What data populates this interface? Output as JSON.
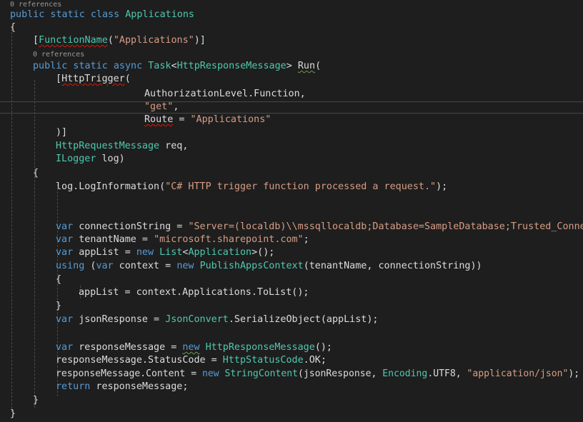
{
  "code_lens": {
    "class_refs": "0 references",
    "method_refs": "0 references"
  },
  "code": {
    "l1": {
      "kw": "public static class",
      "name": "Applications"
    },
    "l2": {
      "brace": "{"
    },
    "l3": {
      "open": "[",
      "attr": "FunctionName",
      "p1": "(",
      "str": "\"Applications\"",
      "close": ")]"
    },
    "l4": {
      "kw": "public static async",
      "task": "Task",
      "lt": "<",
      "resp": "HttpResponseMessage",
      "gt": ">",
      "run": "Run",
      "paren": "("
    },
    "l5": {
      "open": "[",
      "attr": "HttpTrigger",
      "paren": "("
    },
    "l6": {
      "text": "AuthorizationLevel.Function,"
    },
    "l7": {
      "str": "\"get\"",
      "comma": ","
    },
    "l8": {
      "route": "Route",
      "eq": " = ",
      "str": "\"Applications\""
    },
    "l9": {
      "text": ")]"
    },
    "l10": {
      "type": "HttpRequestMessage",
      "rest": " req,"
    },
    "l11": {
      "type": "ILogger",
      "rest": " log)"
    },
    "l12": {
      "brace": "{"
    },
    "l13": {
      "pre": "log.LogInformation(",
      "str": "\"C# HTTP trigger function processed a request.\"",
      "post": ");"
    },
    "l16": {
      "kw": "var",
      "mid": " connectionString = ",
      "str": "\"Server=(localdb)\\\\mssqllocaldb;Database=SampleDatabase;Trusted_Connect"
    },
    "l17": {
      "kw": "var",
      "mid": " tenantName = ",
      "str": "\"microsoft.sharepoint.com\"",
      "post": ";"
    },
    "l18": {
      "kw": "var",
      "mid": " appList = ",
      "kw2": "new",
      "type": "List",
      "lt": "<",
      "type2": "Application",
      "post": ">();"
    },
    "l19": {
      "kw": "using",
      "p1": " (",
      "kw2": "var",
      "mid": " context = ",
      "kw3": "new",
      "type": "PublishAppsContext",
      "post": "(tenantName, connectionString))"
    },
    "l20": {
      "brace": "{"
    },
    "l21": {
      "text": "appList = context.Applications.ToList();"
    },
    "l22": {
      "brace": "}"
    },
    "l23": {
      "kw": "var",
      "mid": " jsonResponse = ",
      "type": "JsonConvert",
      "post": ".SerializeObject(appList);"
    },
    "l25": {
      "kw": "var",
      "mid": " responseMessage = ",
      "kw2": "new",
      "type": "HttpResponseMessage",
      "post": "();"
    },
    "l26": {
      "pre": "responseMessage.StatusCode = ",
      "type": "HttpStatusCode",
      "post": ".OK;"
    },
    "l27": {
      "pre": "responseMessage.Content = ",
      "kw": "new",
      "type": "StringContent",
      "mid": "(jsonResponse, ",
      "type2": "Encoding",
      "mid2": ".UTF8, ",
      "str": "\"application/json\"",
      "post": ");"
    },
    "l28": {
      "kw": "return",
      "post": " responseMessage;"
    },
    "l29": {
      "brace": "}"
    },
    "l30": {
      "brace": "}"
    }
  },
  "colors": {
    "background": "#1e1e1e",
    "keyword": "#569cd6",
    "type": "#4ec9b0",
    "string": "#d69d85",
    "text": "#dcdcdc",
    "codelens": "#999999",
    "error_squiggle": "#e51400"
  }
}
